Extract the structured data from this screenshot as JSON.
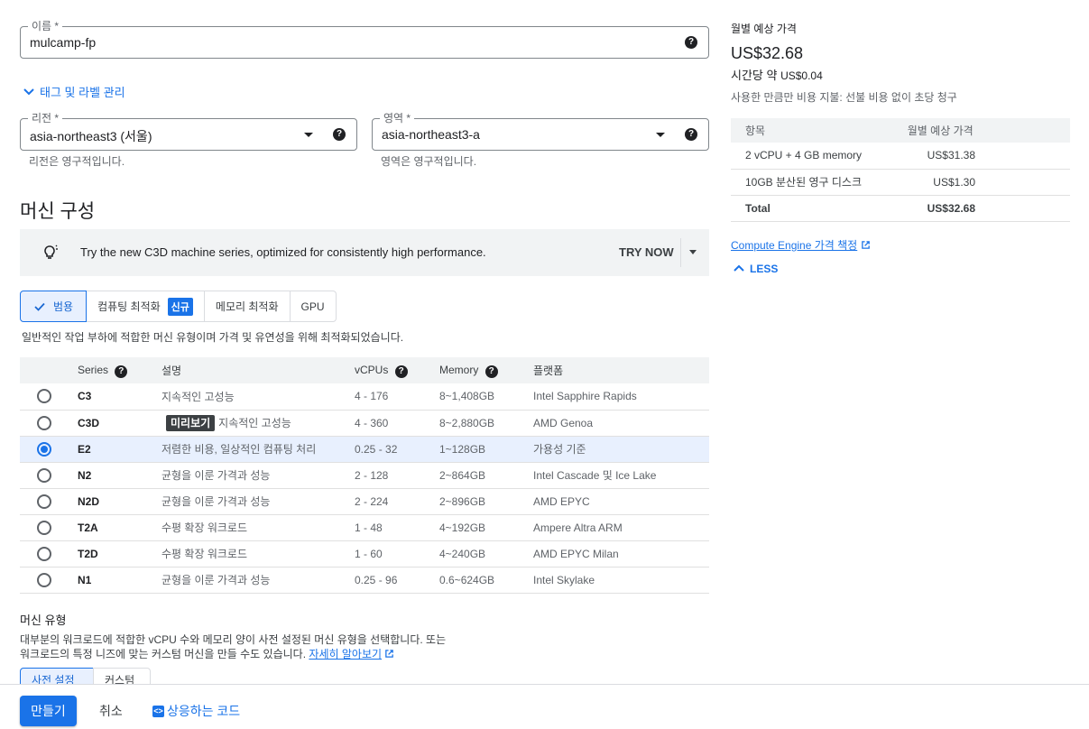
{
  "name_field": {
    "label": "이름 *",
    "value": "mulcamp-fp"
  },
  "tags_toggle": "태그 및 라벨 관리",
  "region": {
    "label": "리전 *",
    "value": "asia-northeast3 (서울)",
    "hint": "리전은 영구적입니다."
  },
  "zone": {
    "label": "영역 *",
    "value": "asia-northeast3-a",
    "hint": "영역은 영구적입니다."
  },
  "machine_config": {
    "title": "머신 구성",
    "banner": {
      "text": "Try the new C3D machine series, optimized for consistently high performance.",
      "button": "TRY NOW"
    },
    "tabs": [
      {
        "label": "범용",
        "active": true
      },
      {
        "label": "컴퓨팅 최적화",
        "badge": "신규"
      },
      {
        "label": "메모리 최적화"
      },
      {
        "label": "GPU"
      }
    ],
    "description": "일반적인 작업 부하에 적합한 머신 유형이며 가격 및 유연성을 위해 최적화되었습니다.",
    "table": {
      "headers": [
        "Series",
        "설명",
        "vCPUs",
        "Memory",
        "플랫폼"
      ],
      "rows": [
        {
          "series": "C3",
          "desc": "지속적인 고성능",
          "vcpus": "4 - 176",
          "memory": "8~1,408GB",
          "platform": "Intel Sapphire Rapids",
          "selected": false
        },
        {
          "series": "C3D",
          "badge": "미리보기",
          "desc": "지속적인 고성능",
          "vcpus": "4 - 360",
          "memory": "8~2,880GB",
          "platform": "AMD Genoa",
          "selected": false
        },
        {
          "series": "E2",
          "desc": "저렴한 비용, 일상적인 컴퓨팅 처리",
          "vcpus": "0.25 - 32",
          "memory": "1~128GB",
          "platform": "가용성 기준",
          "selected": true
        },
        {
          "series": "N2",
          "desc": "균형을 이룬 가격과 성능",
          "vcpus": "2 - 128",
          "memory": "2~864GB",
          "platform": "Intel Cascade 및 Ice Lake",
          "selected": false
        },
        {
          "series": "N2D",
          "desc": "균형을 이룬 가격과 성능",
          "vcpus": "2 - 224",
          "memory": "2~896GB",
          "platform": "AMD EPYC",
          "selected": false
        },
        {
          "series": "T2A",
          "desc": "수평 확장 워크로드",
          "vcpus": "1 - 48",
          "memory": "4~192GB",
          "platform": "Ampere Altra ARM",
          "selected": false
        },
        {
          "series": "T2D",
          "desc": "수평 확장 워크로드",
          "vcpus": "1 - 60",
          "memory": "4~240GB",
          "platform": "AMD EPYC Milan",
          "selected": false
        },
        {
          "series": "N1",
          "desc": "균형을 이룬 가격과 성능",
          "vcpus": "0.25 - 96",
          "memory": "0.6~624GB",
          "platform": "Intel Skylake",
          "selected": false
        }
      ]
    }
  },
  "machine_type": {
    "title": "머신 유형",
    "desc_line1": "대부분의 워크로드에 적합한 vCPU 수와 메모리 양이 사전 설정된 머신 유형을 선택합니다. 또는",
    "desc_line2": "워크로드의 특정 니즈에 맞는 커스텀 머신을 만들 수도 있습니다.",
    "learn_more": "자세히 알아보기",
    "tabs": [
      "사전 설정",
      "커스텀"
    ]
  },
  "pricing": {
    "title": "월별 예상 가격",
    "monthly": "US$32.68",
    "hourly_label": "시간당 약",
    "hourly": "US$0.04",
    "note": "사용한 만큼만 비용 지불: 선불 비용 없이 초당 청구",
    "table_headers": [
      "항목",
      "월별 예상 가격"
    ],
    "items": [
      {
        "item": "2 vCPU + 4 GB memory",
        "price": "US$31.38"
      },
      {
        "item": "10GB 분산된 영구 디스크",
        "price": "US$1.30"
      }
    ],
    "total": {
      "item": "Total",
      "price": "US$32.68"
    },
    "link": "Compute Engine 가격 책정",
    "less": "LESS"
  },
  "footer": {
    "create": "만들기",
    "cancel": "취소",
    "code": "상응하는 코드"
  },
  "colors": {
    "accent": "#1a73e8",
    "text": "#202124",
    "muted": "#5f6368"
  }
}
